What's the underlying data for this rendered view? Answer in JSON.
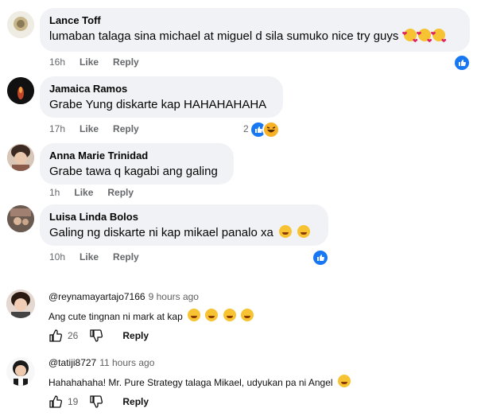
{
  "fb_comments": [
    {
      "author": "Lance Toff",
      "text": "lumaban talaga sina michael at miguel d sila sumuko nice try guys",
      "time": "16h",
      "like": "Like",
      "reply": "Reply",
      "reaction_count": "",
      "emojis": "heart-eyes x3"
    },
    {
      "author": "Jamaica Ramos",
      "text": "Grabe Yung diskarte kap HAHAHAHAHA",
      "time": "17h",
      "like": "Like",
      "reply": "Reply",
      "reaction_count": "2"
    },
    {
      "author": "Anna Marie Trinidad",
      "text": "Grabe tawa q kagabi ang galing",
      "time": "1h",
      "like": "Like",
      "reply": "Reply"
    },
    {
      "author": "Luisa Linda Bolos",
      "text": "Galing ng diskarte ni kap mikael panalo xa",
      "time": "10h",
      "like": "Like",
      "reply": "Reply"
    }
  ],
  "yt_comments": [
    {
      "handle": "@reynamayartajo7166",
      "time": "9 hours ago",
      "text": "Ang cute tingnan ni mark at kap",
      "likes": "26",
      "reply": "Reply"
    },
    {
      "handle": "@tatiji8727",
      "time": "11 hours ago",
      "text": "Hahahahaha! Mr. Pure Strategy talaga Mikael, udyukan pa ni Angel",
      "likes": "19",
      "reply": "Reply"
    }
  ],
  "colors": {
    "bubble": "#f0f2f5",
    "fb_blue": "#1877f2",
    "meta_gray": "#65676b"
  }
}
